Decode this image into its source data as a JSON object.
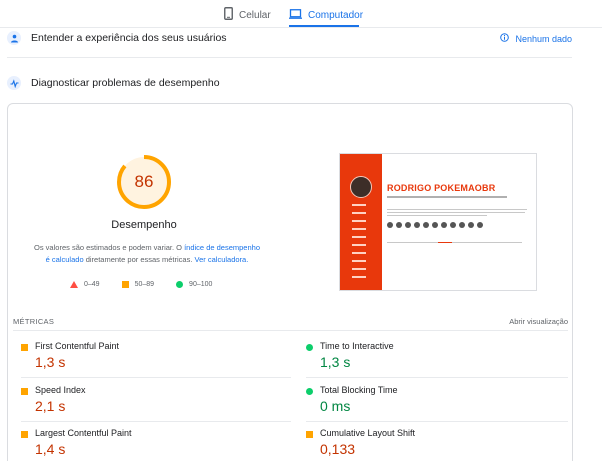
{
  "tabs": [
    {
      "label": "Celular",
      "icon": "phone-icon",
      "active": false
    },
    {
      "label": "Computador",
      "icon": "laptop-icon",
      "active": true
    }
  ],
  "colors": {
    "accent": "#1a73e8",
    "fail": "#ff4e42",
    "average": "#ffa400",
    "average_text": "#c33300",
    "pass": "#0cce6b",
    "pass_text": "#018642"
  },
  "field_section": {
    "title": "Entender a experiência dos seus usuários",
    "no_data_label": "Nenhum dado"
  },
  "lab_section": {
    "title": "Diagnosticar problemas de desempenho"
  },
  "gauge": {
    "score": "86",
    "score_fraction": 0.86,
    "label": "Desempenho",
    "desc_part1": "Os valores são estimados e podem variar. O ",
    "desc_link1": "índice de desempenho é calculado",
    "desc_part2": " diretamente por essas métricas. ",
    "desc_link2": "Ver calculadora."
  },
  "legend": [
    {
      "range": "0–49",
      "shape": "triangle"
    },
    {
      "range": "50–89",
      "shape": "square"
    },
    {
      "range": "90–100",
      "shape": "circle"
    }
  ],
  "preview": {
    "site_name": "RODRIGO POKEMAOBR"
  },
  "metrics": {
    "header": "MÉTRICAS",
    "toggle_label": "Abrir visualização",
    "items": [
      {
        "label": "First Contentful Paint",
        "value": "1,3 s",
        "status": "average"
      },
      {
        "label": "Time to Interactive",
        "value": "1,3 s",
        "status": "pass"
      },
      {
        "label": "Speed Index",
        "value": "2,1 s",
        "status": "average"
      },
      {
        "label": "Total Blocking Time",
        "value": "0 ms",
        "status": "pass"
      },
      {
        "label": "Largest Contentful Paint",
        "value": "1,4 s",
        "status": "average"
      },
      {
        "label": "Cumulative Layout Shift",
        "value": "0,133",
        "status": "average"
      }
    ]
  }
}
